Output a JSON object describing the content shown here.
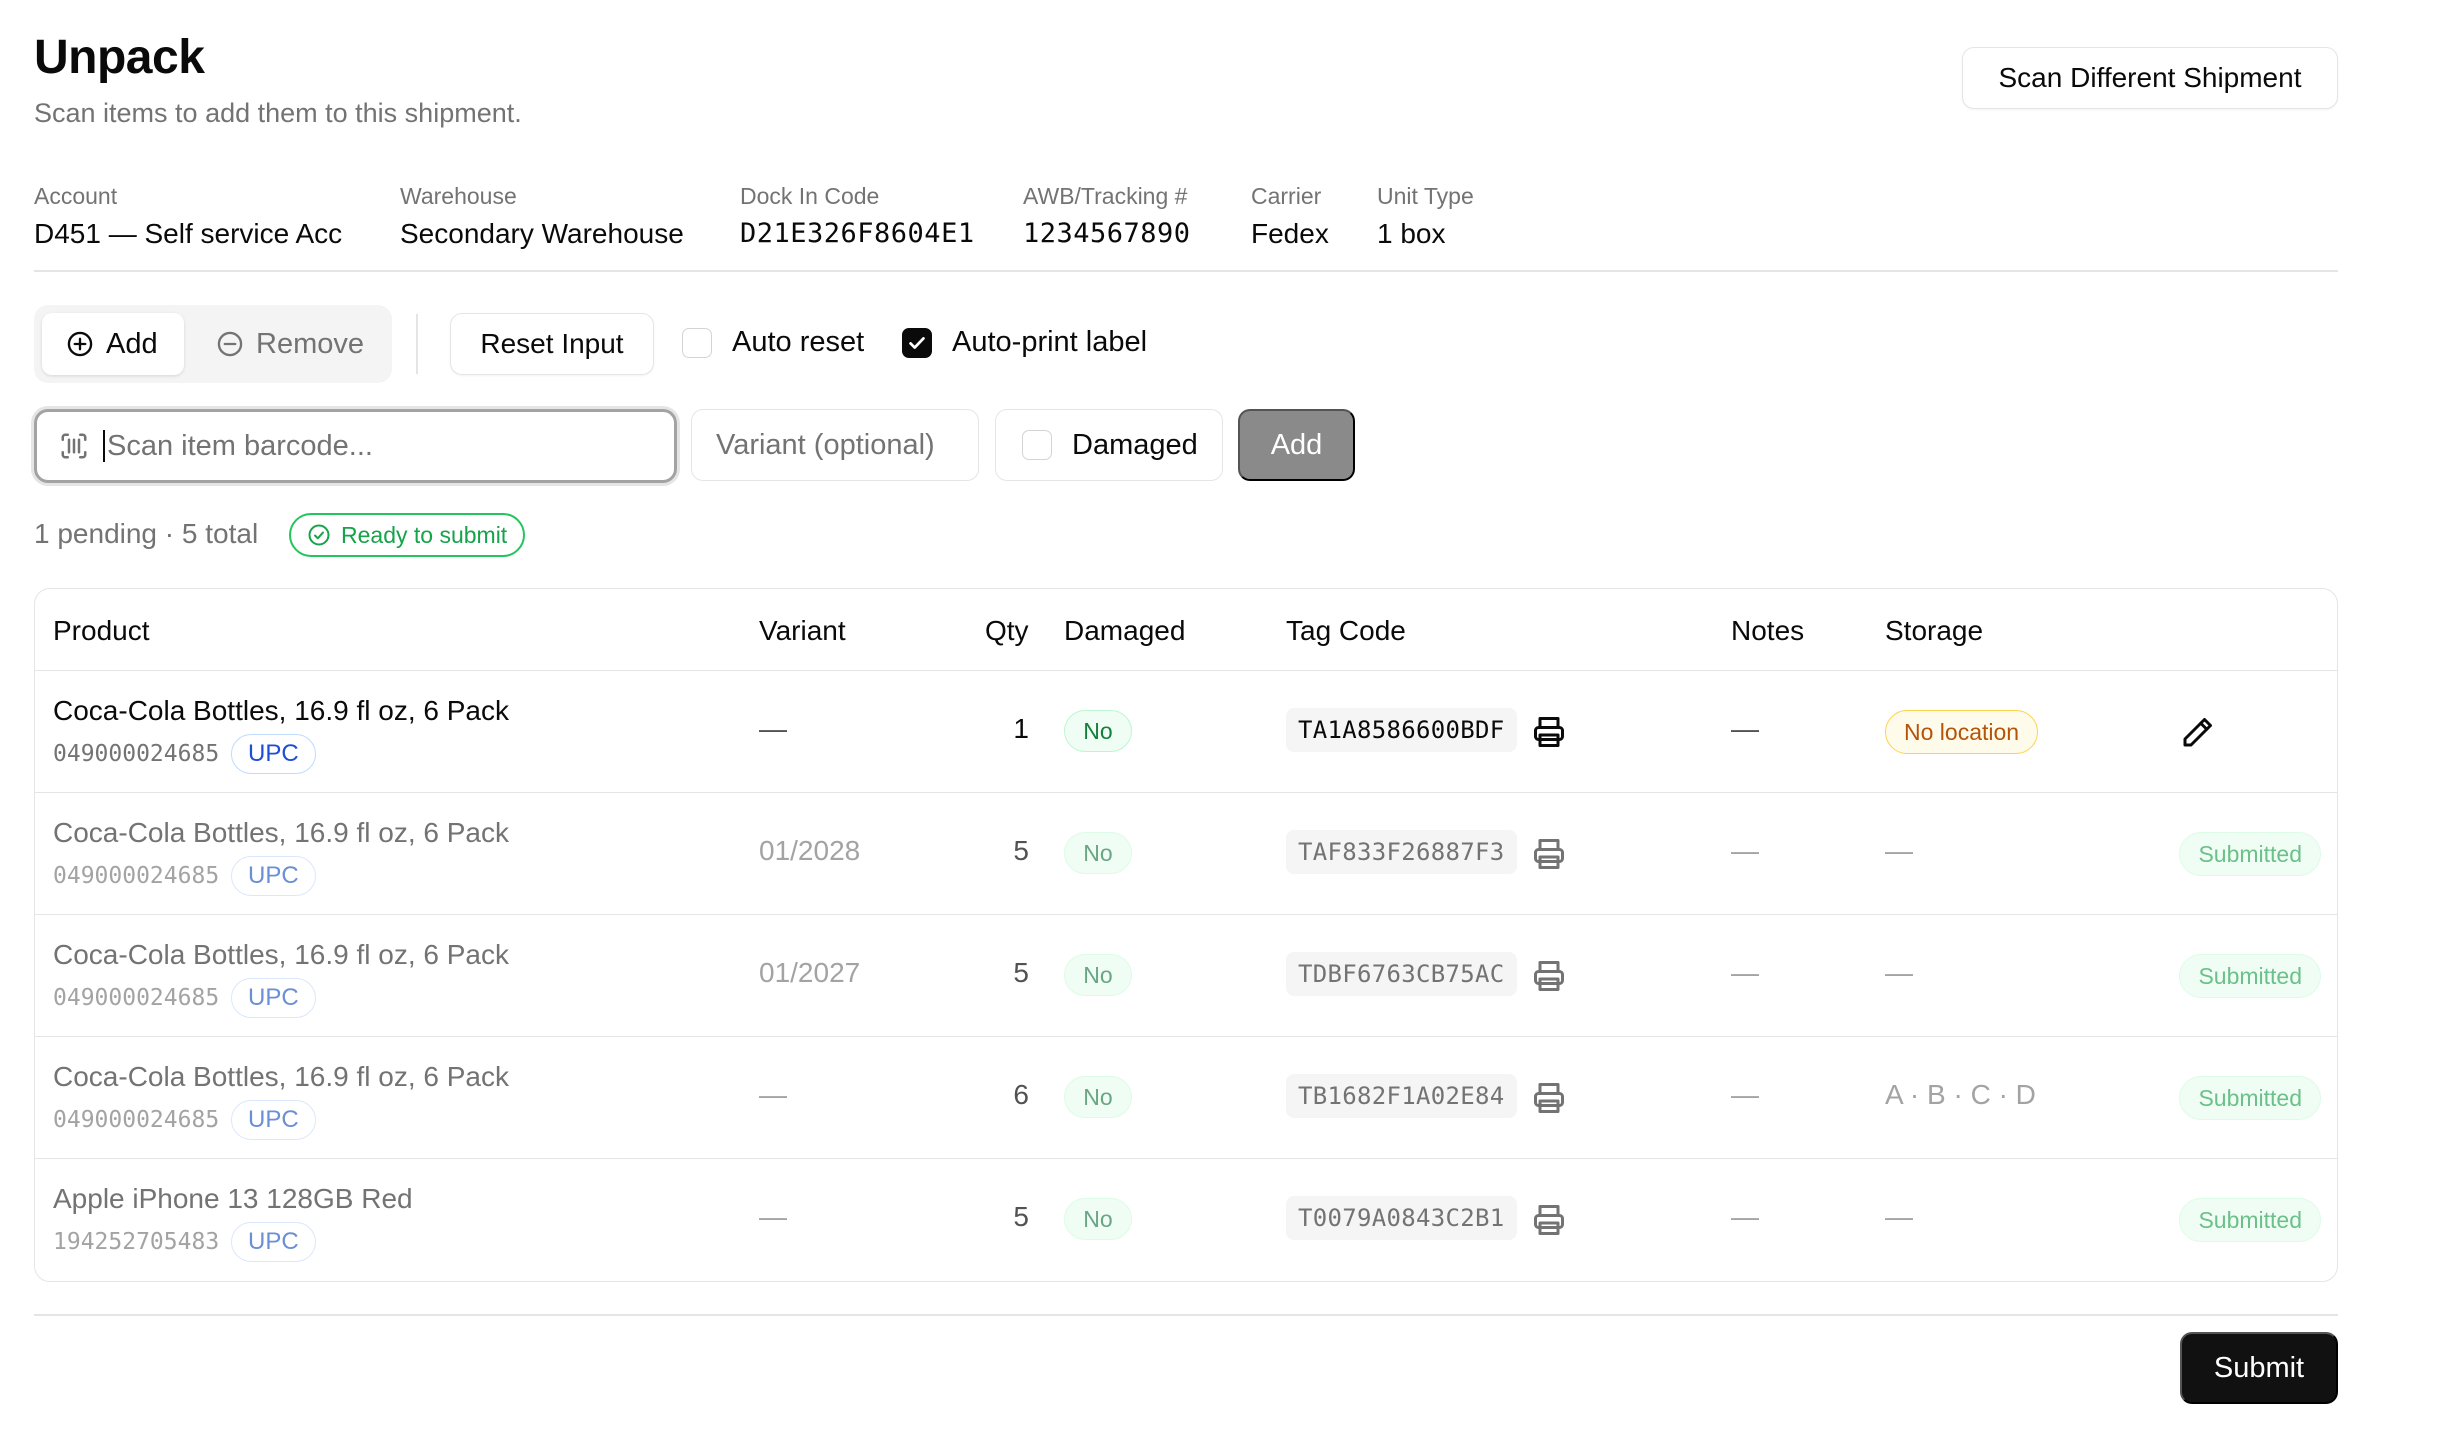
{
  "header": {
    "title": "Unpack",
    "subtitle": "Scan items to add them to this shipment.",
    "scan_different_label": "Scan Different Shipment"
  },
  "meta": [
    {
      "label": "Account",
      "value": "D451 — Self service Acc"
    },
    {
      "label": "Warehouse",
      "value": "Secondary Warehouse"
    },
    {
      "label": "Dock In Code",
      "value": "D21E326F8604E1"
    },
    {
      "label": "AWB/Tracking #",
      "value": "1234567890"
    },
    {
      "label": "Carrier",
      "value": "Fedex"
    },
    {
      "label": "Unit Type",
      "value": "1 box"
    }
  ],
  "toolbar": {
    "mode_add": "Add",
    "mode_remove": "Remove",
    "active_mode": "add",
    "reset_input": "Reset Input",
    "auto_reset_label": "Auto reset",
    "auto_reset_checked": false,
    "auto_print_label": "Auto-print label",
    "auto_print_checked": true
  },
  "scan": {
    "barcode_placeholder": "Scan item barcode...",
    "variant_placeholder": "Variant (optional)",
    "damaged_label": "Damaged",
    "damaged_checked": false,
    "add_label": "Add"
  },
  "status": {
    "counts": "1 pending · 5 total",
    "ready": "Ready to submit"
  },
  "table": {
    "columns": [
      "Product",
      "Variant",
      "Qty",
      "Damaged",
      "Tag Code",
      "Notes",
      "Storage"
    ],
    "rows": [
      {
        "product": "Coca-Cola Bottles, 16.9 fl oz, 6 Pack",
        "sku": "049000024685",
        "code_type": "UPC",
        "variant": "—",
        "qty": "1",
        "damaged": "No",
        "tag_code": "TA1A8586600BDF",
        "notes": "—",
        "storage": "No location",
        "status": "",
        "pending": true
      },
      {
        "product": "Coca-Cola Bottles, 16.9 fl oz, 6 Pack",
        "sku": "049000024685",
        "code_type": "UPC",
        "variant": "01/2028",
        "qty": "5",
        "damaged": "No",
        "tag_code": "TAF833F26887F3",
        "notes": "—",
        "storage": "—",
        "status": "Submitted",
        "pending": false
      },
      {
        "product": "Coca-Cola Bottles, 16.9 fl oz, 6 Pack",
        "sku": "049000024685",
        "code_type": "UPC",
        "variant": "01/2027",
        "qty": "5",
        "damaged": "No",
        "tag_code": "TDBF6763CB75AC",
        "notes": "—",
        "storage": "—",
        "status": "Submitted",
        "pending": false
      },
      {
        "product": "Coca-Cola Bottles, 16.9 fl oz, 6 Pack",
        "sku": "049000024685",
        "code_type": "UPC",
        "variant": "—",
        "qty": "6",
        "damaged": "No",
        "tag_code": "TB1682F1A02E84",
        "notes": "—",
        "storage": "A · B · C · D",
        "status": "Submitted",
        "pending": false
      },
      {
        "product": "Apple iPhone 13 128GB Red",
        "sku": "194252705483",
        "code_type": "UPC",
        "variant": "—",
        "qty": "5",
        "damaged": "No",
        "tag_code": "T0079A0843C2B1",
        "notes": "—",
        "storage": "—",
        "status": "Submitted",
        "pending": false
      }
    ]
  },
  "footer": {
    "submit_label": "Submit"
  },
  "icons": {
    "add_mode": "plus-circle-icon",
    "remove_mode": "minus-circle-icon",
    "scan": "barcode-scan-icon",
    "ready": "check-circle-icon",
    "print": "printer-icon",
    "edit": "pencil-icon",
    "checkbox_checked": "check-icon"
  },
  "colors": {
    "primary": "#111111",
    "ready_green": "#16a34a",
    "upc_blue": "#1d4ed8",
    "no_location_amber": "#b45309"
  }
}
